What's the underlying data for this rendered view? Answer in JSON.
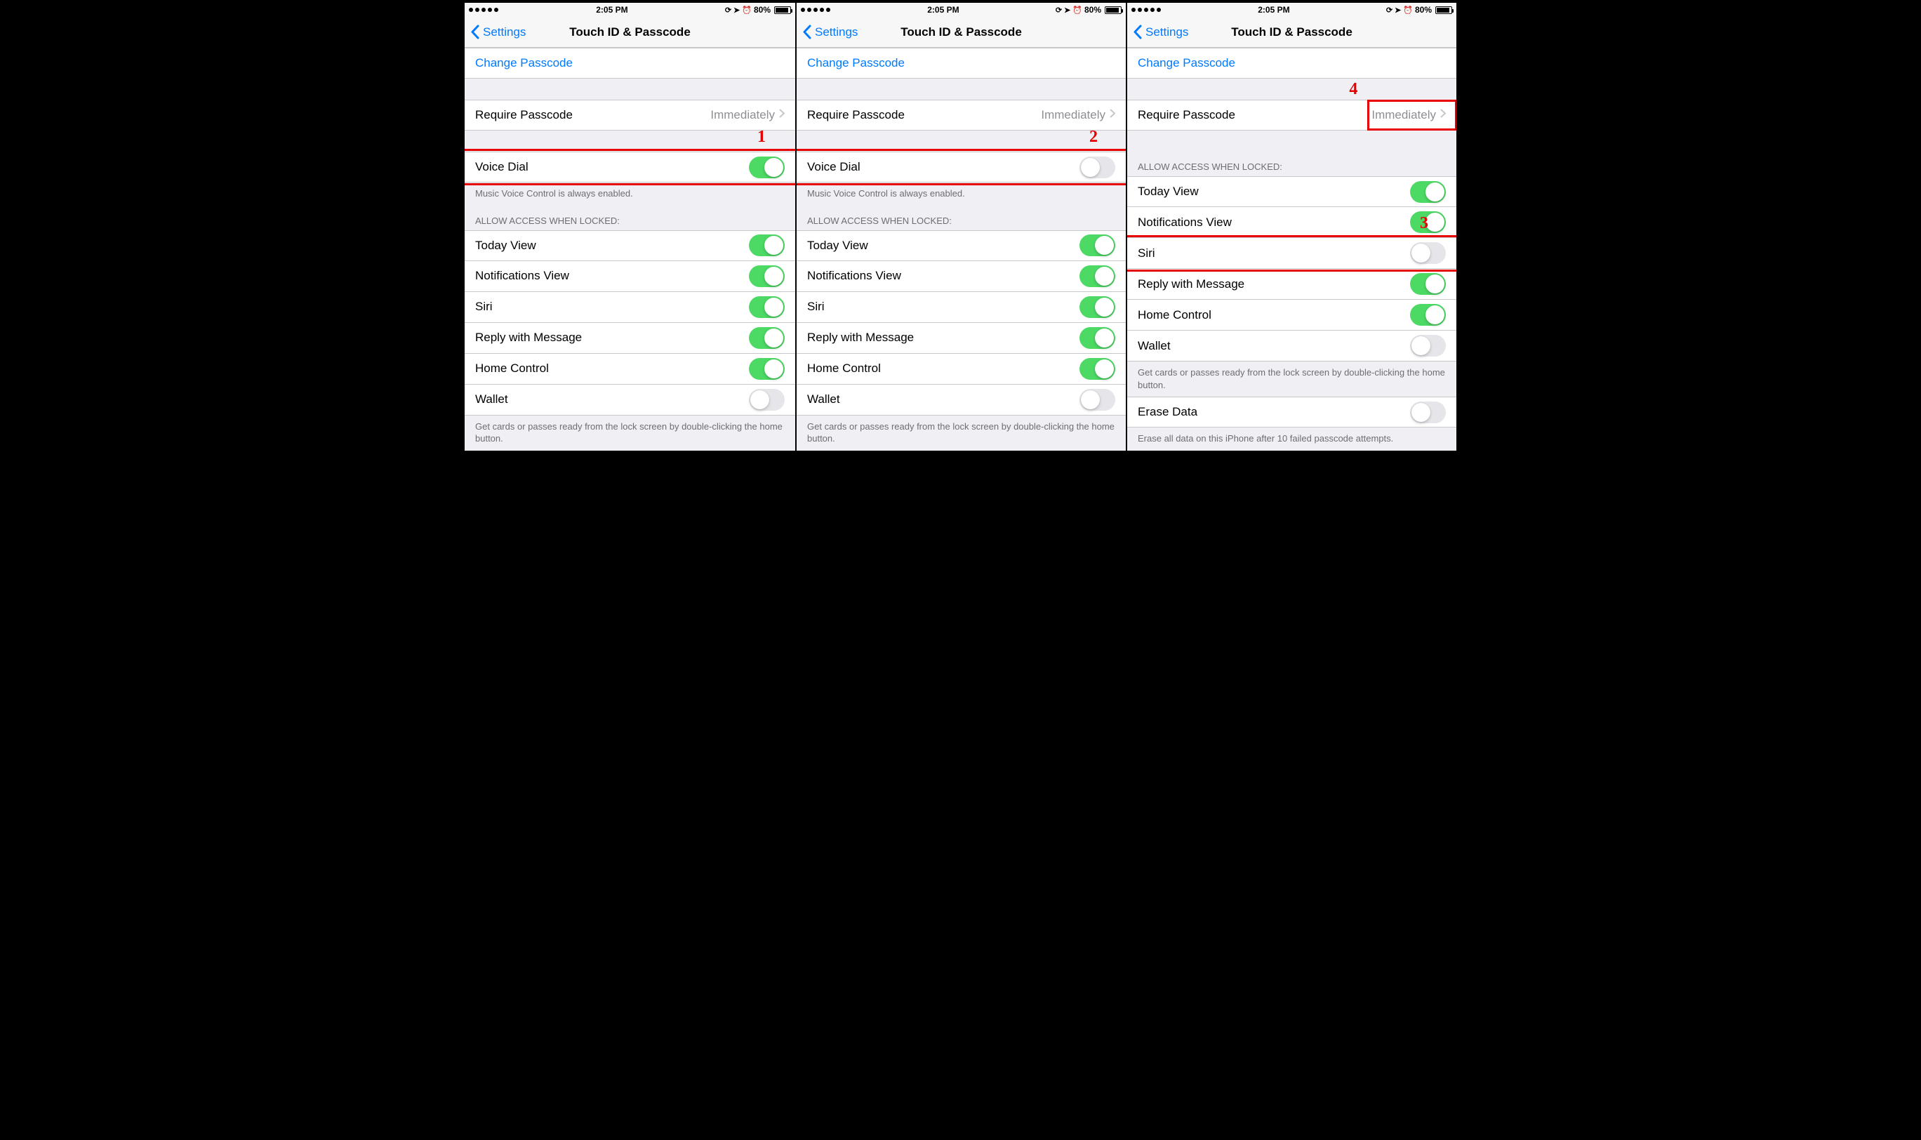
{
  "statusbar": {
    "signal_dots": 5,
    "time": "2:05 PM",
    "battery_pct": "80%",
    "icons": [
      "rotation-lock",
      "location",
      "alarm"
    ]
  },
  "nav": {
    "back_label": "Settings",
    "title": "Touch ID & Passcode"
  },
  "rows": {
    "change_passcode": "Change Passcode",
    "require_passcode": "Require Passcode",
    "require_passcode_value": "Immediately",
    "voice_dial": "Voice Dial",
    "voice_dial_footer": "Music Voice Control is always enabled.",
    "allow_header": "ALLOW ACCESS WHEN LOCKED:",
    "today_view": "Today View",
    "notifications_view": "Notifications View",
    "siri": "Siri",
    "reply_with_message": "Reply with Message",
    "home_control": "Home Control",
    "wallet": "Wallet",
    "wallet_footer": "Get cards or passes ready from the lock screen by double-clicking the home button.",
    "erase_data": "Erase Data",
    "erase_data_footer": "Erase all data on this iPhone after 10 failed passcode attempts."
  },
  "screens": [
    {
      "voice_dial_on": true,
      "show_voice_dial": true,
      "siri_on": true,
      "wallet_on": false,
      "show_erase": false,
      "annot": {
        "num": "1",
        "target": "voice-dial"
      }
    },
    {
      "voice_dial_on": false,
      "show_voice_dial": true,
      "siri_on": true,
      "wallet_on": false,
      "show_erase": false,
      "annot": {
        "num": "2",
        "target": "voice-dial"
      }
    },
    {
      "voice_dial_on": false,
      "show_voice_dial": false,
      "siri_on": false,
      "wallet_on": false,
      "show_erase": true,
      "annot": {
        "num": "3",
        "target": "siri"
      },
      "annot2": {
        "num": "4",
        "target": "require-value"
      }
    }
  ]
}
